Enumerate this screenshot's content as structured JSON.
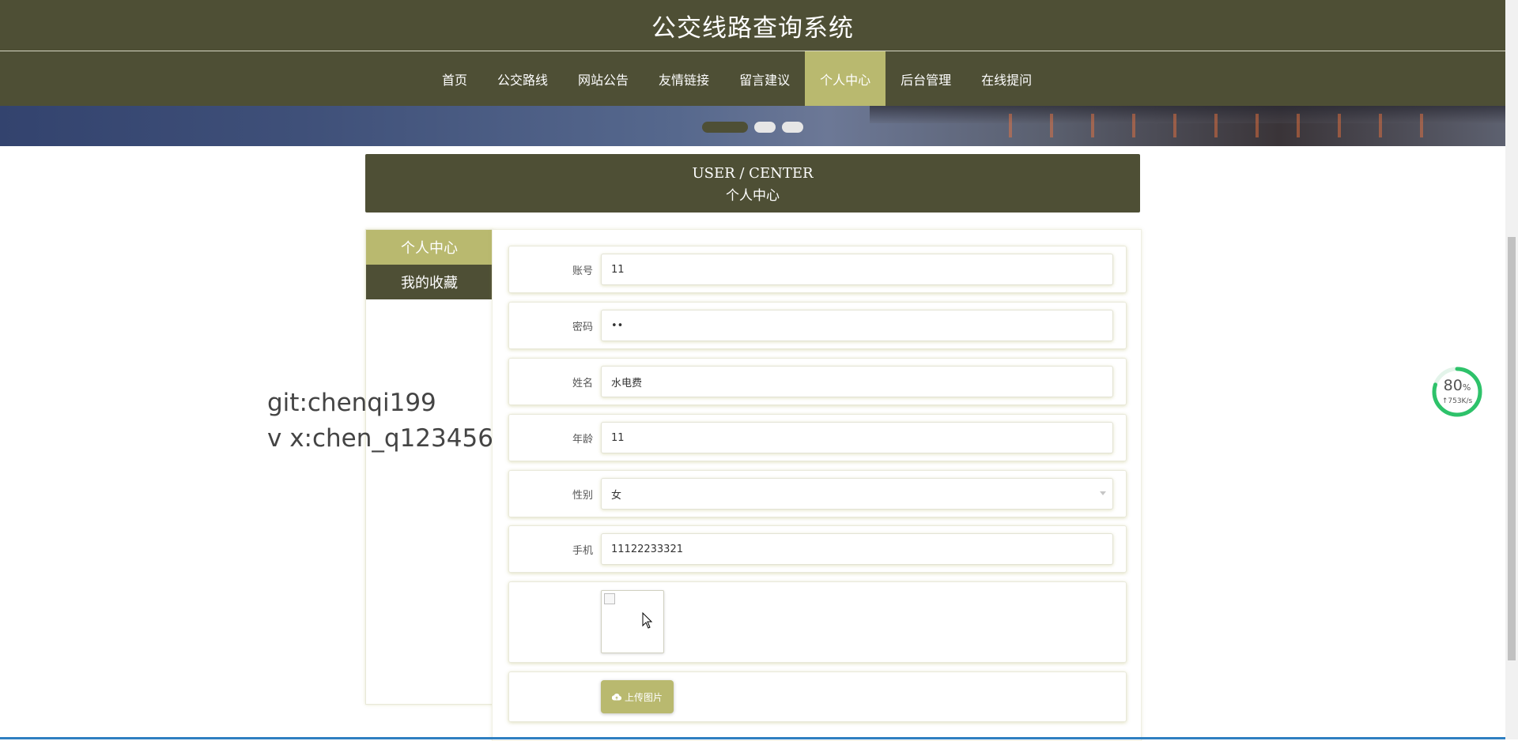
{
  "site": {
    "title": "公交线路查询系统"
  },
  "nav": {
    "items": [
      {
        "label": "首页",
        "active": false
      },
      {
        "label": "公交路线",
        "active": false
      },
      {
        "label": "网站公告",
        "active": false
      },
      {
        "label": "友情链接",
        "active": false
      },
      {
        "label": "留言建议",
        "active": false
      },
      {
        "label": "个人中心",
        "active": true
      },
      {
        "label": "后台管理",
        "active": false
      },
      {
        "label": "在线提问",
        "active": false
      }
    ]
  },
  "carousel": {
    "slide_count": 3,
    "active_index": 0
  },
  "section": {
    "title_en": "USER / CENTER",
    "title_cn": "个人中心"
  },
  "sidebar": {
    "items": [
      {
        "label": "个人中心",
        "active": true
      },
      {
        "label": "我的收藏",
        "active": false
      }
    ]
  },
  "form": {
    "account": {
      "label": "账号",
      "value": "11"
    },
    "password": {
      "label": "密码",
      "value": "••"
    },
    "name": {
      "label": "姓名",
      "value": "水电费"
    },
    "age": {
      "label": "年龄",
      "value": "11"
    },
    "gender": {
      "label": "性别",
      "value": "女"
    },
    "phone": {
      "label": "手机",
      "value": "11122233321"
    },
    "upload_label": "上传图片",
    "upload_icon": "cloud-upload-icon"
  },
  "watermark": {
    "line1": "git:chenqi199",
    "line2": "v x:chen_q123456"
  },
  "speed_widget": {
    "percent": "80",
    "percent_unit": "%",
    "rate": "↑753K/s",
    "ring_value": 0.8
  },
  "colors": {
    "primary": "#4e4f35",
    "accent": "#b9b96f",
    "ring": "#2ec26a"
  }
}
